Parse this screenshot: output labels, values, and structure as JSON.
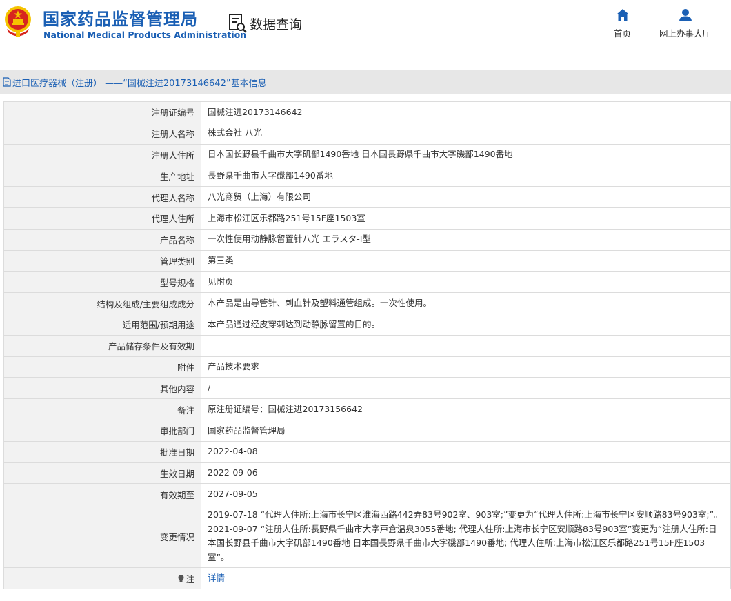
{
  "header": {
    "brand_cn": "国家药品监督管理局",
    "brand_en": "National Medical Products Administration",
    "query_label": "数据查询",
    "nav_home": "首页",
    "nav_hall": "网上办事大厅"
  },
  "section": {
    "title": "进口医疗器械（注册） ——“国械注进20173146642”基本信息"
  },
  "fields": [
    {
      "label": "注册证编号",
      "value": "国械注进20173146642"
    },
    {
      "label": "注册人名称",
      "value": "株式会社 八光"
    },
    {
      "label": "注册人住所",
      "value": "日本国长野县千曲市大字矶部1490番地 日本国長野県千曲市大字磯部1490番地"
    },
    {
      "label": "生产地址",
      "value": "長野県千曲市大字磯部1490番地"
    },
    {
      "label": "代理人名称",
      "value": "八光商贸（上海）有限公司"
    },
    {
      "label": "代理人住所",
      "value": "上海市松江区乐都路251号15F座1503室"
    },
    {
      "label": "产品名称",
      "value": "一次性使用动静脉留置针八光 エラスタ-Ⅰ型"
    },
    {
      "label": "管理类别",
      "value": "第三类"
    },
    {
      "label": "型号规格",
      "value": "见附页"
    },
    {
      "label": "结构及组成/主要组成成分",
      "value": "本产品是由导管针、刺血针及塑料通管组成。一次性使用。"
    },
    {
      "label": "适用范围/预期用途",
      "value": "本产品通过经皮穿刺达到动静脉留置的目的。"
    },
    {
      "label": "产品储存条件及有效期",
      "value": ""
    },
    {
      "label": "附件",
      "value": "产品技术要求"
    },
    {
      "label": "其他内容",
      "value": "/"
    },
    {
      "label": "备注",
      "value": "原注册证编号：国械注进20173156642"
    },
    {
      "label": "审批部门",
      "value": "国家药品监督管理局"
    },
    {
      "label": "批准日期",
      "value": "2022-04-08"
    },
    {
      "label": "生效日期",
      "value": "2022-09-06"
    },
    {
      "label": "有效期至",
      "value": "2027-09-05"
    }
  ],
  "changes": {
    "label": "变更情况",
    "entries": [
      "2019-07-18 “代理人住所:上海市长宁区淮海西路442弄83号902室、903室;”变更为“代理人住所:上海市长宁区安顺路83号903室;”。",
      "2021-09-07 “注册人住所:長野県千曲市大字戸倉温泉3055番地; 代理人住所:上海市长宁区安顺路83号903室”变更为“注册人住所:日本国长野县千曲市大字矶部1490番地 日本国長野県千曲市大字磯部1490番地; 代理人住所:上海市松江区乐都路251号15F座1503室”。"
    ]
  },
  "note": {
    "label": "注",
    "link": "详情"
  },
  "icons": {
    "emblem": "national-emblem-icon",
    "query": "search-document-icon",
    "home": "home-icon",
    "hall": "user-icon",
    "section": "document-icon",
    "note": "lightbulb-icon"
  },
  "colors": {
    "brand_blue": "#1a5fb4",
    "label_bg": "#f2f2f2",
    "section_bg": "#e7e7e7",
    "emblem_red": "#d7261e",
    "emblem_gold": "#f5c400"
  }
}
